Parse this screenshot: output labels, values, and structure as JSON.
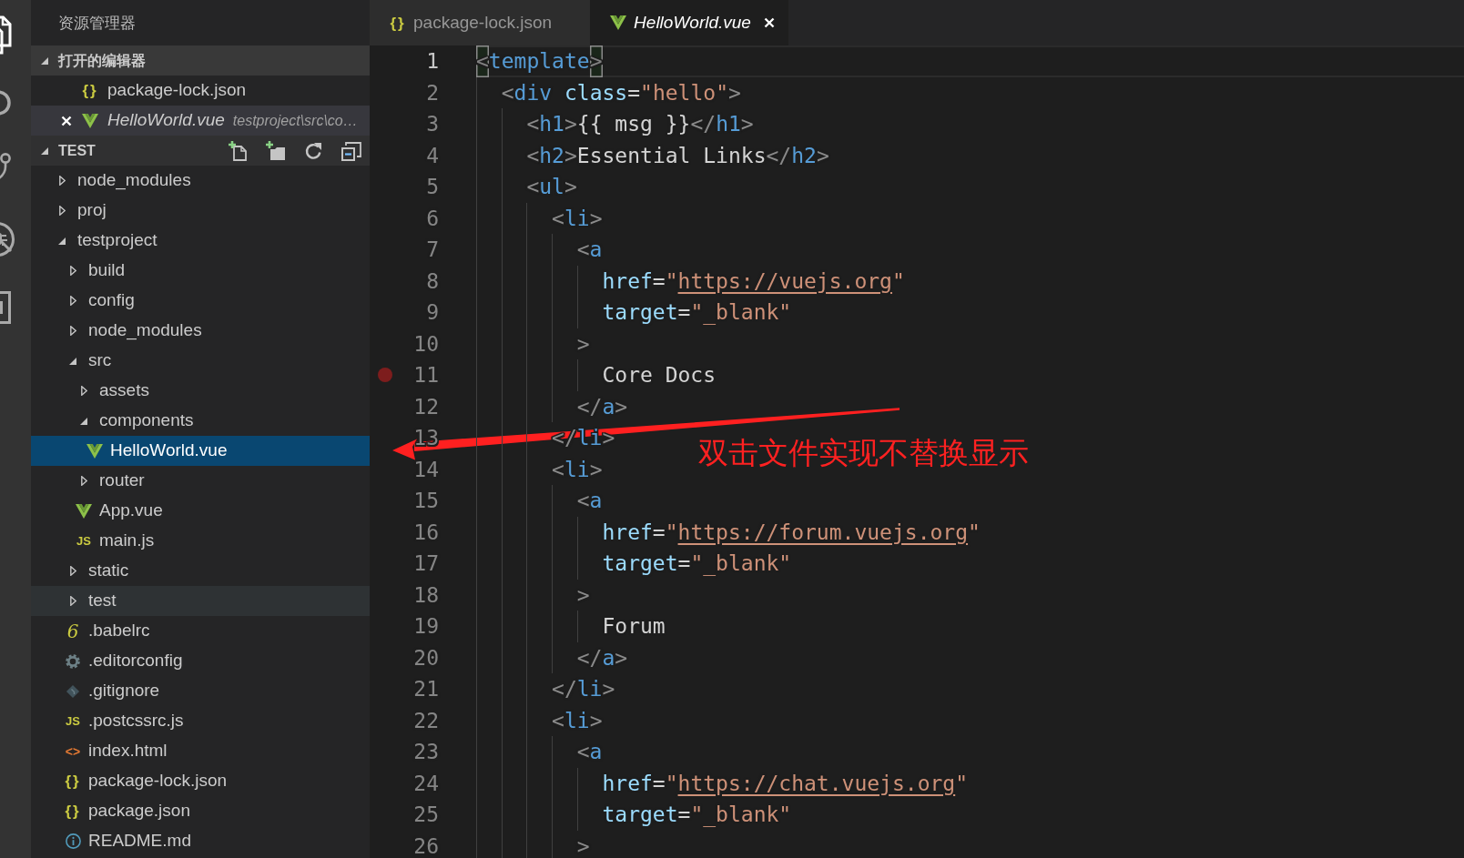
{
  "activity_bar": [
    {
      "kind": "explorer",
      "selected": true
    },
    {
      "kind": "search",
      "selected": false
    },
    {
      "kind": "scm",
      "selected": false
    },
    {
      "kind": "debug",
      "selected": false
    },
    {
      "kind": "extensions",
      "selected": false
    }
  ],
  "sidebar": {
    "title": "资源管理器",
    "open_editors": {
      "title": "打开的编辑器",
      "expanded": true,
      "items": [
        {
          "name": "package-lock.json",
          "kind": "json",
          "icon_text": "{}",
          "preview": false,
          "selected": false
        },
        {
          "name": "HelloWorld.vue",
          "kind": "vue",
          "description": "testproject\\src\\co…",
          "preview": true,
          "selected": true
        }
      ]
    },
    "folder": {
      "title": "TEST",
      "expanded": true,
      "tree": [
        {
          "name": "node_modules",
          "kind": "folder",
          "expanded": false,
          "selected": false,
          "hovered": false
        },
        {
          "name": "proj",
          "kind": "folder",
          "expanded": false,
          "selected": false,
          "hovered": false
        },
        {
          "name": "testproject",
          "kind": "folder",
          "expanded": true,
          "selected": false,
          "hovered": false,
          "children": [
            {
              "name": "build",
              "kind": "folder",
              "expanded": false,
              "selected": false,
              "hovered": false
            },
            {
              "name": "config",
              "kind": "folder",
              "expanded": false,
              "selected": false,
              "hovered": false
            },
            {
              "name": "node_modules",
              "kind": "folder",
              "expanded": false,
              "selected": false,
              "hovered": false
            },
            {
              "name": "src",
              "kind": "folder",
              "expanded": true,
              "selected": false,
              "hovered": false,
              "children": [
                {
                  "name": "assets",
                  "kind": "folder",
                  "expanded": false,
                  "selected": false,
                  "hovered": false
                },
                {
                  "name": "components",
                  "kind": "folder",
                  "expanded": true,
                  "selected": false,
                  "hovered": false,
                  "children": [
                    {
                      "name": "HelloWorld.vue",
                      "kind": "vue",
                      "selected": true,
                      "hovered": false
                    }
                  ]
                },
                {
                  "name": "router",
                  "kind": "folder",
                  "expanded": false,
                  "selected": false,
                  "hovered": false
                },
                {
                  "name": "App.vue",
                  "kind": "vue",
                  "selected": false,
                  "hovered": false
                },
                {
                  "name": "main.js",
                  "kind": "script",
                  "icon_text": "JS",
                  "selected": false,
                  "hovered": false
                }
              ]
            },
            {
              "name": "static",
              "kind": "folder",
              "expanded": false,
              "selected": false,
              "hovered": false
            },
            {
              "name": "test",
              "kind": "folder",
              "expanded": false,
              "selected": false,
              "hovered": true
            },
            {
              "name": ".babelrc",
              "kind": "babel",
              "icon_text": "6",
              "selected": false,
              "hovered": false
            },
            {
              "name": ".editorconfig",
              "kind": "settings",
              "selected": false,
              "hovered": false
            },
            {
              "name": ".gitignore",
              "kind": "git",
              "selected": false,
              "hovered": false
            },
            {
              "name": ".postcssrc.js",
              "kind": "script",
              "icon_text": "JS",
              "selected": false,
              "hovered": false
            },
            {
              "name": "index.html",
              "kind": "markup",
              "icon_text": "<>",
              "selected": false,
              "hovered": false
            },
            {
              "name": "package-lock.json",
              "kind": "json",
              "icon_text": "{}",
              "selected": false,
              "hovered": false
            },
            {
              "name": "package.json",
              "kind": "json",
              "icon_text": "{}",
              "selected": false,
              "hovered": false
            },
            {
              "name": "README.md",
              "kind": "info",
              "selected": false,
              "hovered": false
            }
          ]
        }
      ]
    }
  },
  "editor": {
    "tabs": [
      {
        "label": "package-lock.json",
        "kind": "json",
        "icon_text": "{}",
        "preview": false,
        "selected": false
      },
      {
        "label": "HelloWorld.vue",
        "kind": "vue",
        "preview": true,
        "selected": true
      }
    ],
    "lines": [
      {
        "number": "1",
        "current": true,
        "breakpoint": false,
        "tokens": [
          {
            "kind": "matched",
            "text": "<"
          },
          {
            "kind": "tag",
            "text": "template"
          },
          {
            "kind": "matched",
            "text": ">"
          }
        ],
        "children": [
          {
            "number": "2",
            "current": false,
            "breakpoint": false,
            "tokens": [
              {
                "kind": "punct",
                "text": "<"
              },
              {
                "kind": "tag",
                "text": "div"
              },
              {
                "kind": "attr",
                "text": " class"
              },
              {
                "kind": "op",
                "text": "="
              },
              {
                "kind": "string",
                "text": "\"hello\""
              },
              {
                "kind": "punct",
                "text": ">"
              }
            ],
            "children": [
              {
                "number": "3",
                "current": false,
                "breakpoint": false,
                "tokens": [
                  {
                    "kind": "punct",
                    "text": "<"
                  },
                  {
                    "kind": "tag",
                    "text": "h1"
                  },
                  {
                    "kind": "punct",
                    "text": ">"
                  },
                  {
                    "kind": "text",
                    "text": "{{ msg }}"
                  },
                  {
                    "kind": "punct",
                    "text": "</"
                  },
                  {
                    "kind": "tag",
                    "text": "h1"
                  },
                  {
                    "kind": "punct",
                    "text": ">"
                  }
                ]
              },
              {
                "number": "4",
                "current": false,
                "breakpoint": false,
                "tokens": [
                  {
                    "kind": "punct",
                    "text": "<"
                  },
                  {
                    "kind": "tag",
                    "text": "h2"
                  },
                  {
                    "kind": "punct",
                    "text": ">"
                  },
                  {
                    "kind": "text",
                    "text": "Essential Links"
                  },
                  {
                    "kind": "punct",
                    "text": "</"
                  },
                  {
                    "kind": "tag",
                    "text": "h2"
                  },
                  {
                    "kind": "punct",
                    "text": ">"
                  }
                ]
              },
              {
                "number": "5",
                "current": false,
                "breakpoint": false,
                "tokens": [
                  {
                    "kind": "punct",
                    "text": "<"
                  },
                  {
                    "kind": "tag",
                    "text": "ul"
                  },
                  {
                    "kind": "punct",
                    "text": ">"
                  }
                ],
                "children": [
                  {
                    "number": "6",
                    "current": false,
                    "breakpoint": false,
                    "tokens": [
                      {
                        "kind": "punct",
                        "text": "<"
                      },
                      {
                        "kind": "tag",
                        "text": "li"
                      },
                      {
                        "kind": "punct",
                        "text": ">"
                      }
                    ],
                    "children": [
                      {
                        "number": "7",
                        "current": false,
                        "breakpoint": false,
                        "tokens": [
                          {
                            "kind": "punct",
                            "text": "<"
                          },
                          {
                            "kind": "tag",
                            "text": "a"
                          }
                        ],
                        "children": [
                          {
                            "number": "8",
                            "current": false,
                            "breakpoint": false,
                            "tokens": [
                              {
                                "kind": "attr",
                                "text": "href"
                              },
                              {
                                "kind": "op",
                                "text": "="
                              },
                              {
                                "kind": "string",
                                "text": "\""
                              },
                              {
                                "kind": "link",
                                "text": "https://vuejs.org"
                              },
                              {
                                "kind": "string",
                                "text": "\""
                              }
                            ]
                          },
                          {
                            "number": "9",
                            "current": false,
                            "breakpoint": false,
                            "tokens": [
                              {
                                "kind": "attr",
                                "text": "target"
                              },
                              {
                                "kind": "op",
                                "text": "="
                              },
                              {
                                "kind": "string",
                                "text": "\"_blank\""
                              }
                            ]
                          }
                        ]
                      },
                      {
                        "number": "10",
                        "current": false,
                        "breakpoint": false,
                        "tokens": [
                          {
                            "kind": "punct",
                            "text": ">"
                          }
                        ],
                        "children": [
                          {
                            "number": "11",
                            "current": false,
                            "breakpoint": true,
                            "tokens": [
                              {
                                "kind": "text",
                                "text": "Core Docs"
                              }
                            ]
                          }
                        ]
                      },
                      {
                        "number": "12",
                        "current": false,
                        "breakpoint": false,
                        "tokens": [
                          {
                            "kind": "punct",
                            "text": "</"
                          },
                          {
                            "kind": "tag",
                            "text": "a"
                          },
                          {
                            "kind": "punct",
                            "text": ">"
                          }
                        ]
                      }
                    ]
                  },
                  {
                    "number": "13",
                    "current": false,
                    "breakpoint": false,
                    "tokens": [
                      {
                        "kind": "punct",
                        "text": "</"
                      },
                      {
                        "kind": "tag",
                        "text": "li"
                      },
                      {
                        "kind": "punct",
                        "text": ">"
                      }
                    ]
                  },
                  {
                    "number": "14",
                    "current": false,
                    "breakpoint": false,
                    "tokens": [
                      {
                        "kind": "punct",
                        "text": "<"
                      },
                      {
                        "kind": "tag",
                        "text": "li"
                      },
                      {
                        "kind": "punct",
                        "text": ">"
                      }
                    ],
                    "children": [
                      {
                        "number": "15",
                        "current": false,
                        "breakpoint": false,
                        "tokens": [
                          {
                            "kind": "punct",
                            "text": "<"
                          },
                          {
                            "kind": "tag",
                            "text": "a"
                          }
                        ],
                        "children": [
                          {
                            "number": "16",
                            "current": false,
                            "breakpoint": false,
                            "tokens": [
                              {
                                "kind": "attr",
                                "text": "href"
                              },
                              {
                                "kind": "op",
                                "text": "="
                              },
                              {
                                "kind": "string",
                                "text": "\""
                              },
                              {
                                "kind": "link",
                                "text": "https://forum.vuejs.org"
                              },
                              {
                                "kind": "string",
                                "text": "\""
                              }
                            ]
                          },
                          {
                            "number": "17",
                            "current": false,
                            "breakpoint": false,
                            "tokens": [
                              {
                                "kind": "attr",
                                "text": "target"
                              },
                              {
                                "kind": "op",
                                "text": "="
                              },
                              {
                                "kind": "string",
                                "text": "\"_blank\""
                              }
                            ]
                          }
                        ]
                      },
                      {
                        "number": "18",
                        "current": false,
                        "breakpoint": false,
                        "tokens": [
                          {
                            "kind": "punct",
                            "text": ">"
                          }
                        ],
                        "children": [
                          {
                            "number": "19",
                            "current": false,
                            "breakpoint": false,
                            "tokens": [
                              {
                                "kind": "text",
                                "text": "Forum"
                              }
                            ]
                          }
                        ]
                      },
                      {
                        "number": "20",
                        "current": false,
                        "breakpoint": false,
                        "tokens": [
                          {
                            "kind": "punct",
                            "text": "</"
                          },
                          {
                            "kind": "tag",
                            "text": "a"
                          },
                          {
                            "kind": "punct",
                            "text": ">"
                          }
                        ]
                      }
                    ]
                  },
                  {
                    "number": "21",
                    "current": false,
                    "breakpoint": false,
                    "tokens": [
                      {
                        "kind": "punct",
                        "text": "</"
                      },
                      {
                        "kind": "tag",
                        "text": "li"
                      },
                      {
                        "kind": "punct",
                        "text": ">"
                      }
                    ]
                  },
                  {
                    "number": "22",
                    "current": false,
                    "breakpoint": false,
                    "tokens": [
                      {
                        "kind": "punct",
                        "text": "<"
                      },
                      {
                        "kind": "tag",
                        "text": "li"
                      },
                      {
                        "kind": "punct",
                        "text": ">"
                      }
                    ],
                    "children": [
                      {
                        "number": "23",
                        "current": false,
                        "breakpoint": false,
                        "tokens": [
                          {
                            "kind": "punct",
                            "text": "<"
                          },
                          {
                            "kind": "tag",
                            "text": "a"
                          }
                        ],
                        "children": [
                          {
                            "number": "24",
                            "current": false,
                            "breakpoint": false,
                            "tokens": [
                              {
                                "kind": "attr",
                                "text": "href"
                              },
                              {
                                "kind": "op",
                                "text": "="
                              },
                              {
                                "kind": "string",
                                "text": "\""
                              },
                              {
                                "kind": "link",
                                "text": "https://chat.vuejs.org"
                              },
                              {
                                "kind": "string",
                                "text": "\""
                              }
                            ]
                          },
                          {
                            "number": "25",
                            "current": false,
                            "breakpoint": false,
                            "tokens": [
                              {
                                "kind": "attr",
                                "text": "target"
                              },
                              {
                                "kind": "op",
                                "text": "="
                              },
                              {
                                "kind": "string",
                                "text": "\"_blank\""
                              }
                            ]
                          }
                        ]
                      },
                      {
                        "number": "26",
                        "current": false,
                        "breakpoint": false,
                        "tokens": [
                          {
                            "kind": "punct",
                            "text": ">"
                          }
                        ]
                      }
                    ]
                  }
                ]
              }
            ]
          }
        ]
      }
    ]
  },
  "annotation": {
    "text": "双击文件实现不替换显示"
  }
}
